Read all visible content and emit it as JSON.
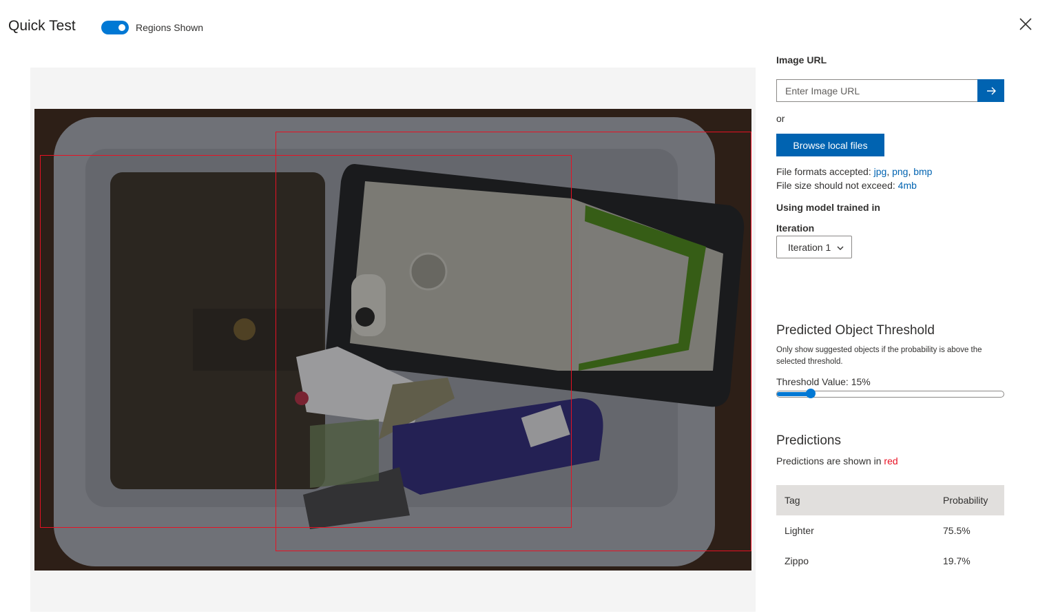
{
  "header": {
    "title": "Quick Test",
    "toggle_label": "Regions Shown",
    "toggle_on": true
  },
  "image": {
    "regions": [
      {
        "tag": "Lighter"
      },
      {
        "tag": "Zippo"
      }
    ]
  },
  "sidebar": {
    "image_url_label": "Image URL",
    "image_url_placeholder": "Enter Image URL",
    "image_url_value": "",
    "or_text": "or",
    "browse_label": "Browse local files",
    "formats_prefix": "File formats accepted: ",
    "formats": [
      "jpg",
      "png",
      "bmp"
    ],
    "size_prefix": "File size should not exceed: ",
    "size_limit": "4mb",
    "model_label": "Using model trained in",
    "iteration_label": "Iteration",
    "iteration_selected": "Iteration 1",
    "threshold_title": "Predicted Object Threshold",
    "threshold_description": "Only show suggested objects if the probability is above the selected threshold.",
    "threshold_label": "Threshold Value: 15%",
    "threshold_value": 0.15,
    "predictions_title": "Predictions",
    "predictions_note_prefix": "Predictions are shown in ",
    "predictions_note_color_word": "red",
    "accent_color": "#0063b1",
    "prediction_color": "#e81123",
    "table": {
      "headers": [
        "Tag",
        "Probability"
      ],
      "rows": [
        {
          "tag": "Lighter",
          "probability": "75.5%"
        },
        {
          "tag": "Zippo",
          "probability": "19.7%"
        }
      ]
    }
  },
  "icons": {
    "close": "close-icon",
    "go": "arrow-right-icon",
    "dropdown": "chevron-down-icon"
  }
}
